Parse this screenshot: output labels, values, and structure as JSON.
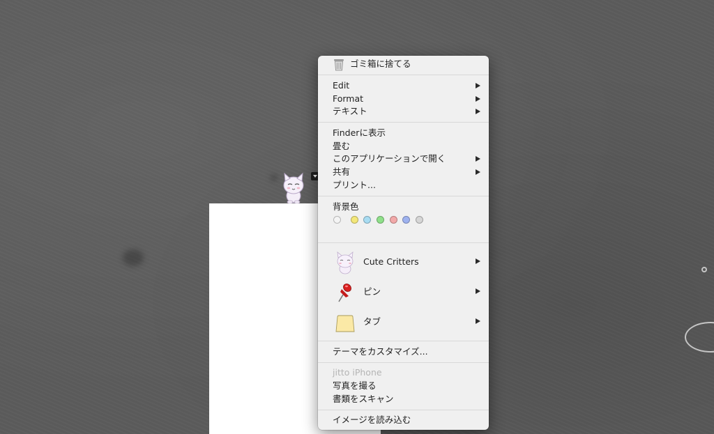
{
  "context_menu": {
    "trash": {
      "label": "ゴミ箱に捨てる",
      "icon": "trash-icon"
    },
    "group1": [
      {
        "label": "Edit",
        "has_submenu": true
      },
      {
        "label": "Format",
        "has_submenu": true
      },
      {
        "label": "テキスト",
        "has_submenu": true
      }
    ],
    "group2": [
      {
        "label": "Finderに表示",
        "has_submenu": false
      },
      {
        "label": "畳む",
        "has_submenu": false
      },
      {
        "label": "このアプリケーションで開く",
        "has_submenu": true
      },
      {
        "label": "共有",
        "has_submenu": true
      },
      {
        "label": "プリント...",
        "has_submenu": false
      }
    ],
    "background_color": {
      "label": "背景色",
      "swatches": [
        {
          "name": "none",
          "color": "#f4f4f4"
        },
        {
          "name": "yellow",
          "color": "#f3e77a"
        },
        {
          "name": "light-blue",
          "color": "#a8dcf2"
        },
        {
          "name": "green",
          "color": "#8fe08a"
        },
        {
          "name": "pink",
          "color": "#f2a9a9"
        },
        {
          "name": "blue",
          "color": "#9eb2ef"
        },
        {
          "name": "gray",
          "color": "#d6d6d6"
        }
      ]
    },
    "stickers": [
      {
        "label": "Cute Critters",
        "icon": "cat-icon",
        "has_submenu": true
      },
      {
        "label": "ピン",
        "icon": "pushpin-icon",
        "has_submenu": true
      },
      {
        "label": "タブ",
        "icon": "tab-icon",
        "has_submenu": true
      }
    ],
    "customize_theme": {
      "label": "テーマをカスタマイズ..."
    },
    "iphone": {
      "device_label": "jitto iPhone",
      "items": [
        {
          "label": "写真を撮る"
        },
        {
          "label": "書類をスキャン"
        }
      ]
    },
    "import_image": {
      "label": "イメージを読み込む"
    }
  },
  "desktop": {
    "sticker_icon": "cat-sticker-icon",
    "background_color": "#5b5b5b"
  }
}
